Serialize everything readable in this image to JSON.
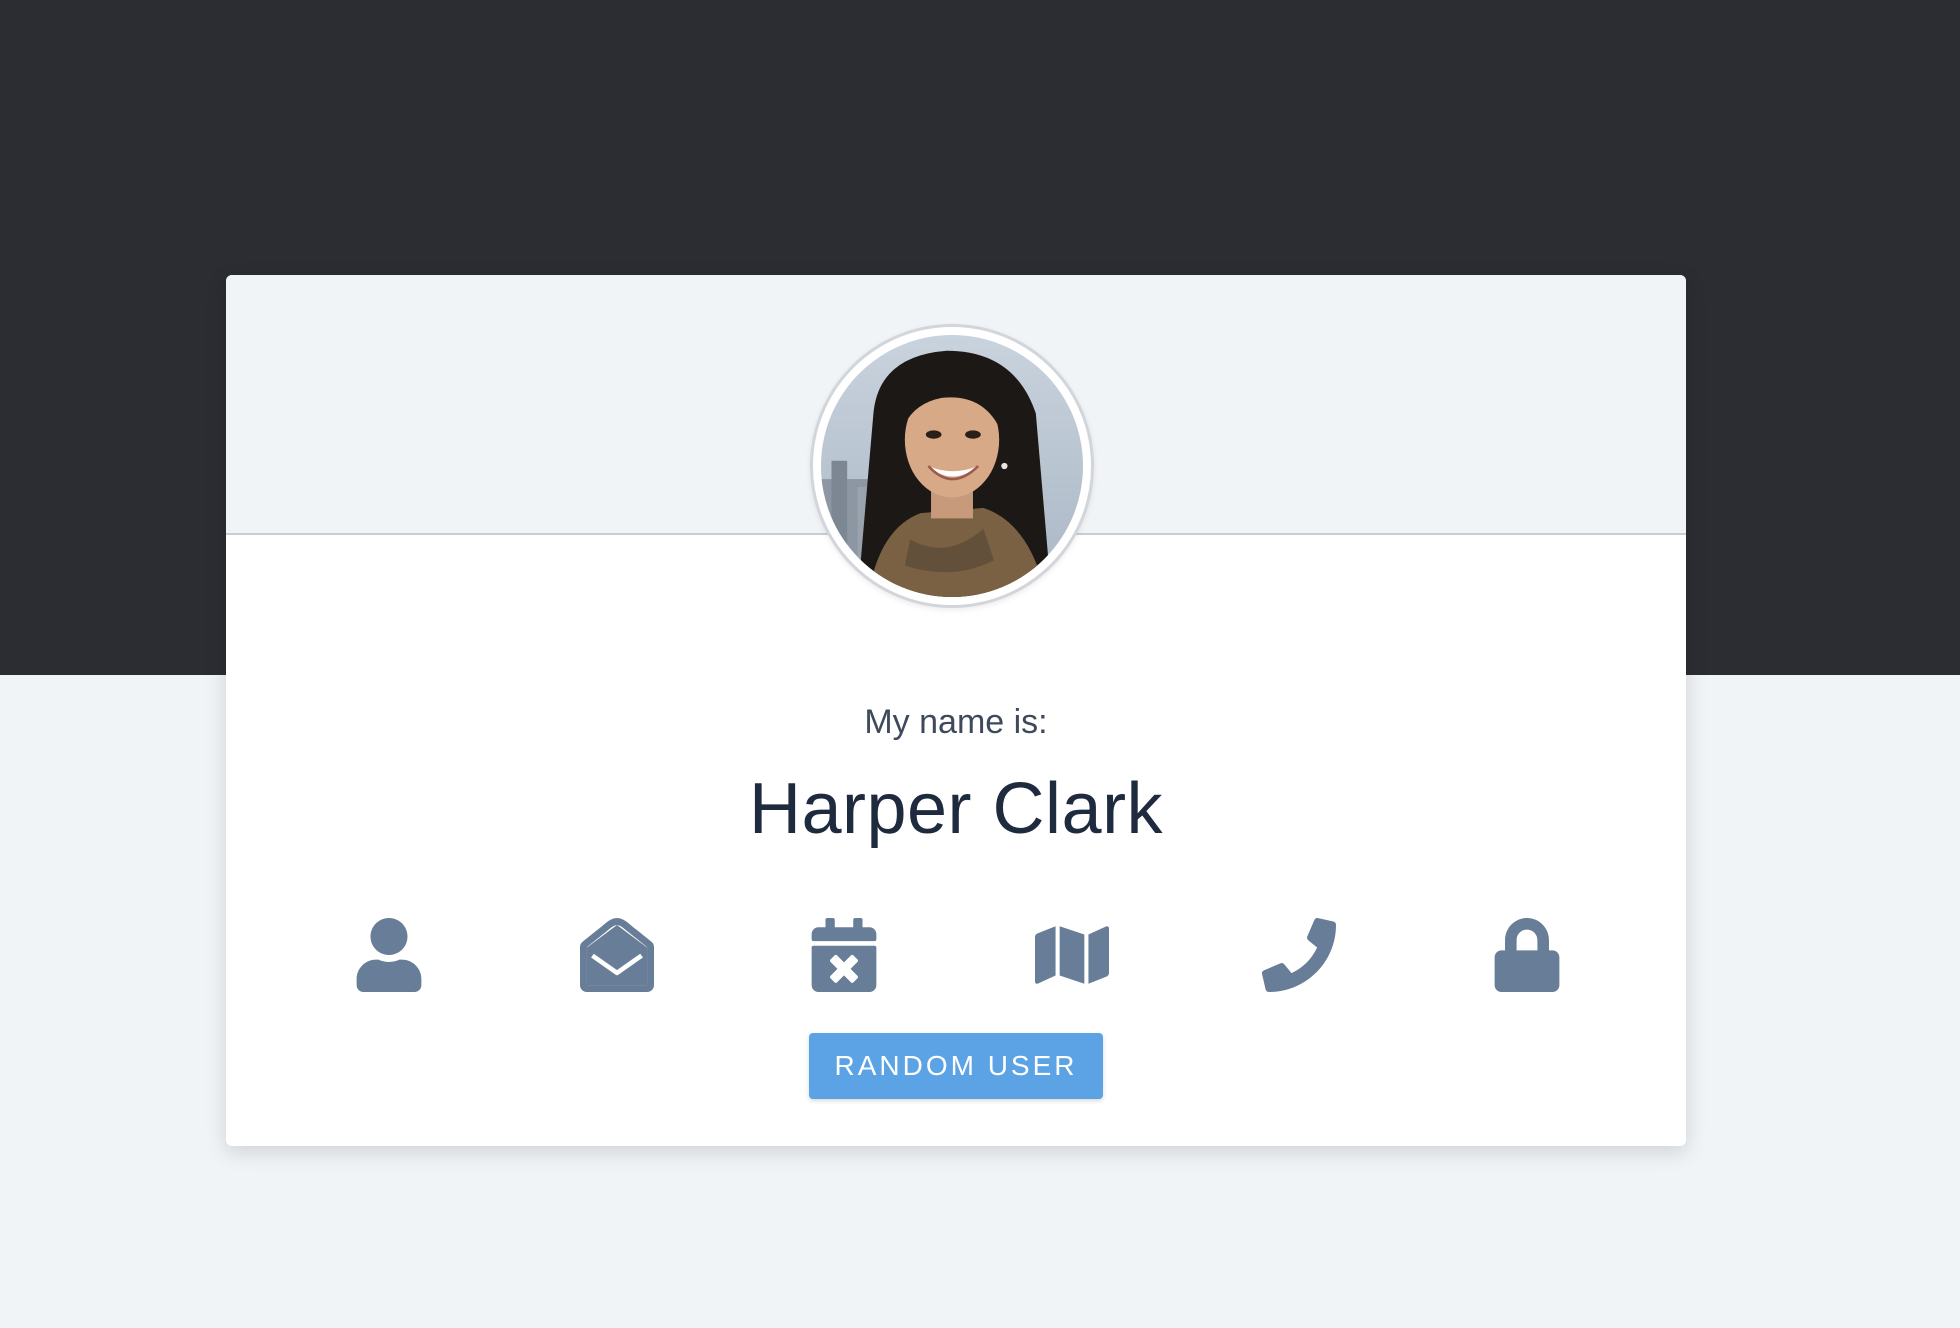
{
  "profile": {
    "label": "My name is:",
    "value": "Harper Clark"
  },
  "icons": [
    {
      "name": "user-icon"
    },
    {
      "name": "envelope-open-icon"
    },
    {
      "name": "calendar-x-icon"
    },
    {
      "name": "map-icon"
    },
    {
      "name": "phone-icon"
    },
    {
      "name": "lock-icon"
    }
  ],
  "actions": {
    "random_user_label": "RANDOM USER"
  },
  "colors": {
    "top_band": "#2c2d33",
    "page_background": "#f1f4f7",
    "icon": "#687d97",
    "button": "#5ca3e6",
    "name_text": "#1e2a3d"
  }
}
